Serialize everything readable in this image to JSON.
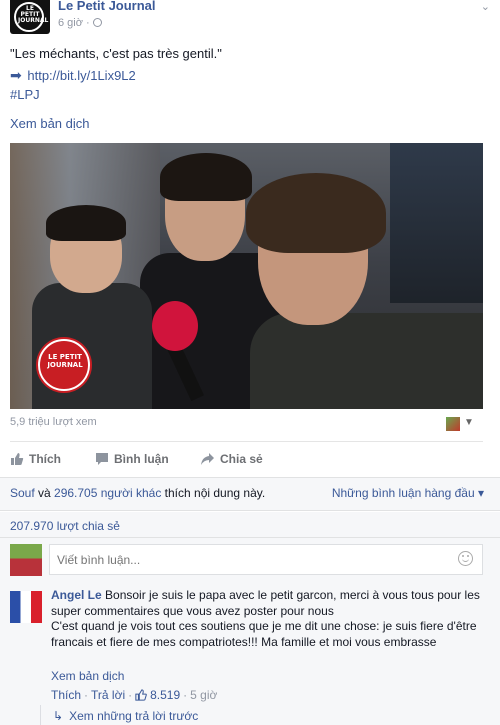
{
  "header": {
    "logo_text": "LE PETIT JOURNAL",
    "page_name": "Le Petit Journal",
    "time": "6 giờ · ",
    "menu_glyph": "⌄"
  },
  "post": {
    "quote": "\"Les méchants, c'est pas très gentil.\"",
    "link": "http://bit.ly/1Lix9L2",
    "hashtag": "#LPJ",
    "see_translation": "Xem bản dịch"
  },
  "video": {
    "logo_text": "LE PETIT JOURNAL",
    "views": "5,9 triệu lượt xem"
  },
  "actions": {
    "like": "Thích",
    "comment": "Bình luận",
    "share": "Chia sẻ"
  },
  "likes": {
    "name": "Souf",
    "middle": " và ",
    "others": "296.705 người khác",
    "suffix": " thích nội dung này.",
    "top_comments": "Những bình luận hàng đầu ▾"
  },
  "shares": {
    "count": "207.970 lượt chia sẻ"
  },
  "comment_box": {
    "placeholder": "Viết bình luận..."
  },
  "comment": {
    "author": "Angel Le",
    "text1": "Bonsoir je suis le papa avec le petit garcon, merci à vous tous pour les super commentaires que vous avez poster pour nous",
    "text2": "C'est quand je vois tout ces soutiens que je me dit une chose: je suis fiere d'être francais et fiere de mes compatriotes!!! Ma famille et moi vous embrasse",
    "translate": "Xem bản dịch",
    "like": "Thích",
    "reply": "Trả lời",
    "likes": "8.519",
    "time": "5 giờ",
    "separator": "·",
    "view_replies": "Xem những trả lời trước"
  },
  "colors": {
    "link": "#3b5998",
    "muted": "#9197a3",
    "panel": "#f6f7f9"
  }
}
